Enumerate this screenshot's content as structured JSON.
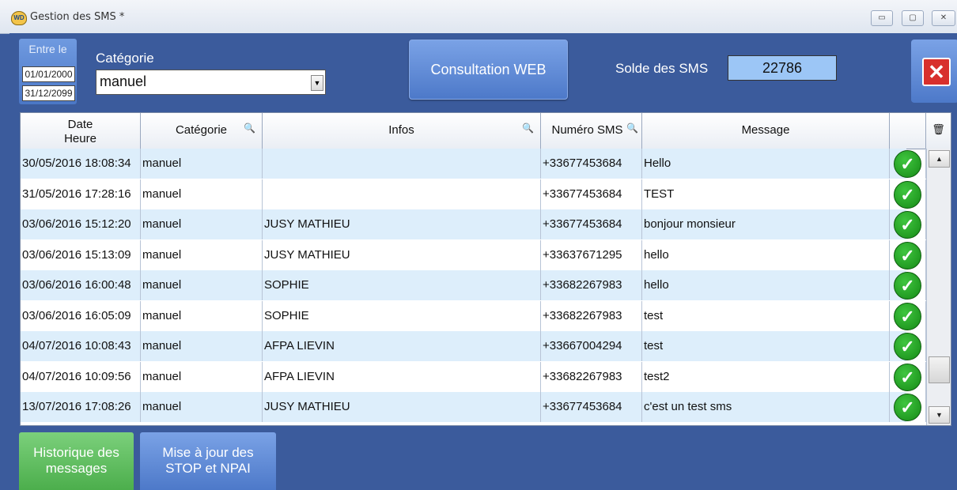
{
  "window": {
    "title": "Gestion des SMS *",
    "app_icon_text": "WD",
    "minimize": "▭",
    "maximize": "▢",
    "close": "✕"
  },
  "filters": {
    "entre_label": "Entre le",
    "date_from": "01/01/2000",
    "date_to": "31/12/2099",
    "categorie_label": "Catégorie",
    "categorie_value": "manuel"
  },
  "buttons": {
    "web": "Consultation WEB",
    "close_symbol": "✕"
  },
  "solde": {
    "label": "Solde des SMS",
    "value": "22786"
  },
  "table": {
    "columns": {
      "date_line1": "Date",
      "date_line2": "Heure",
      "categorie": "Catégorie",
      "infos": "Infos",
      "numero": "Numéro SMS",
      "message": "Message"
    },
    "rows": [
      {
        "date": "30/05/2016 18:08:34",
        "categorie": "manuel",
        "infos": "",
        "numero": "+33677453684",
        "message": "Hello"
      },
      {
        "date": "31/05/2016 17:28:16",
        "categorie": "manuel",
        "infos": "",
        "numero": "+33677453684",
        "message": "TEST"
      },
      {
        "date": "03/06/2016 15:12:20",
        "categorie": "manuel",
        "infos": "JUSY MATHIEU",
        "numero": "+33677453684",
        "message": "bonjour monsieur"
      },
      {
        "date": "03/06/2016 15:13:09",
        "categorie": "manuel",
        "infos": "JUSY MATHIEU",
        "numero": "+33637671295",
        "message": "hello"
      },
      {
        "date": "03/06/2016 16:00:48",
        "categorie": "manuel",
        "infos": "SOPHIE",
        "numero": "+33682267983",
        "message": "hello"
      },
      {
        "date": "03/06/2016 16:05:09",
        "categorie": "manuel",
        "infos": "SOPHIE",
        "numero": "+33682267983",
        "message": "test"
      },
      {
        "date": "04/07/2016 10:08:43",
        "categorie": "manuel",
        "infos": "AFPA LIEVIN",
        "numero": "+33667004294",
        "message": "test"
      },
      {
        "date": "04/07/2016 10:09:56",
        "categorie": "manuel",
        "infos": "AFPA LIEVIN",
        "numero": "+33682267983",
        "message": "test2"
      },
      {
        "date": "13/07/2016 17:08:26",
        "categorie": "manuel",
        "infos": "JUSY MATHIEU",
        "numero": "+33677453684",
        "message": "c'est un test sms"
      }
    ]
  },
  "tabs": {
    "historique_line1": "Historique des",
    "historique_line2": "messages",
    "miseajour_line1": "Mise à jour des",
    "miseajour_line2": "STOP et NPAI"
  },
  "colors": {
    "background": "#3b5b9c",
    "row_alt": "#ddeefb",
    "status_ok": "#1e9e1e",
    "active_tab": "#5cb85c"
  },
  "icons": {
    "status": "check-circle-icon",
    "search": "magnifier-icon",
    "delete": "trash-icon"
  }
}
